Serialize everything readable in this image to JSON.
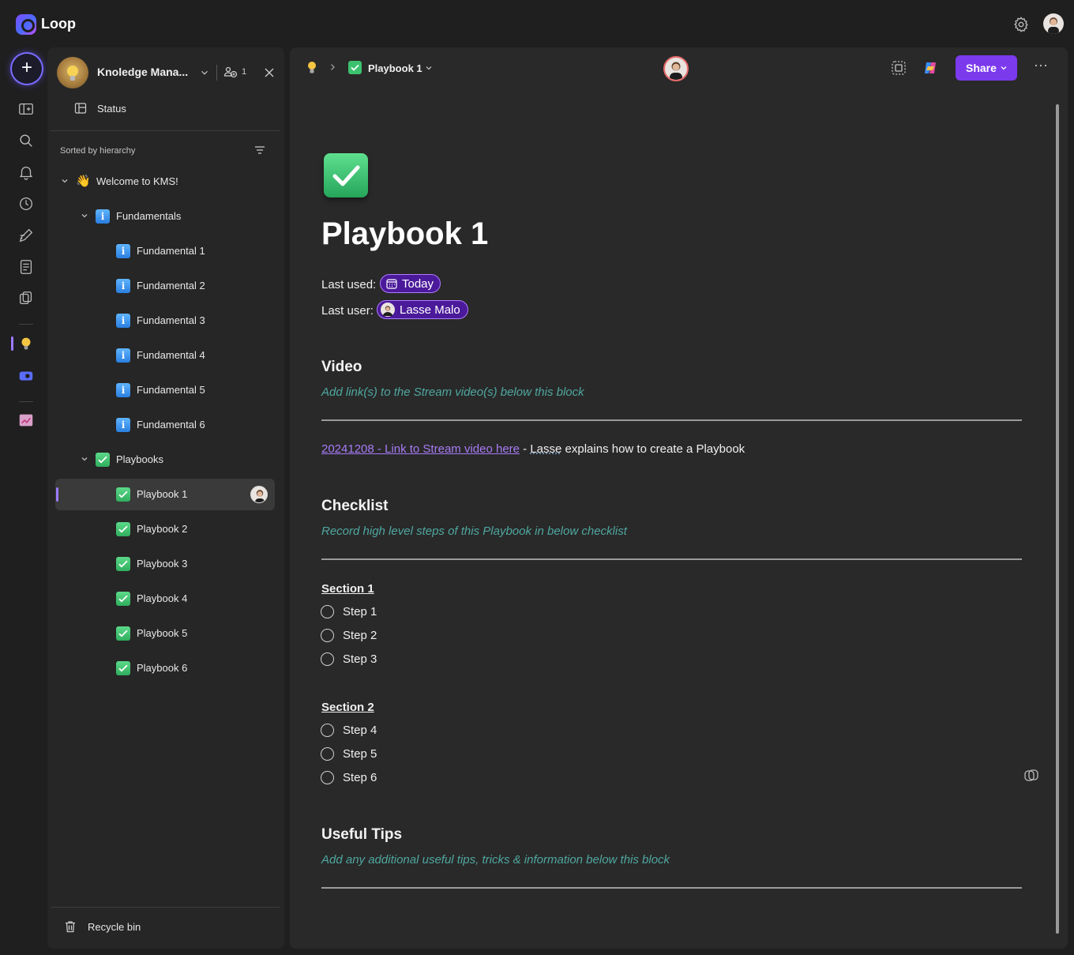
{
  "app": {
    "name": "Loop"
  },
  "workspace": {
    "name": "Knoledge Mana...",
    "members_count": "1"
  },
  "sidebar": {
    "status_label": "Status",
    "sort_label": "Sorted by hierarchy",
    "tree": [
      {
        "label": "Welcome to KMS!",
        "level": 0,
        "icon": "waving-hand-icon",
        "expanded": true
      },
      {
        "label": "Fundamentals",
        "level": 1,
        "icon": "info-icon",
        "expanded": true
      },
      {
        "label": "Fundamental 1",
        "level": 2,
        "icon": "info-icon"
      },
      {
        "label": "Fundamental 2",
        "level": 2,
        "icon": "info-icon"
      },
      {
        "label": "Fundamental 3",
        "level": 2,
        "icon": "info-icon"
      },
      {
        "label": "Fundamental 4",
        "level": 2,
        "icon": "info-icon"
      },
      {
        "label": "Fundamental 5",
        "level": 2,
        "icon": "info-icon"
      },
      {
        "label": "Fundamental 6",
        "level": 2,
        "icon": "info-icon"
      },
      {
        "label": "Playbooks",
        "level": 1,
        "icon": "checkmark-icon",
        "expanded": true
      },
      {
        "label": "Playbook 1",
        "level": 2,
        "icon": "checkmark-icon",
        "active": true
      },
      {
        "label": "Playbook 2",
        "level": 2,
        "icon": "checkmark-icon"
      },
      {
        "label": "Playbook 3",
        "level": 2,
        "icon": "checkmark-icon"
      },
      {
        "label": "Playbook 4",
        "level": 2,
        "icon": "checkmark-icon"
      },
      {
        "label": "Playbook 5",
        "level": 2,
        "icon": "checkmark-icon"
      },
      {
        "label": "Playbook 6",
        "level": 2,
        "icon": "checkmark-icon"
      }
    ],
    "recycle_label": "Recycle bin"
  },
  "toolbar": {
    "breadcrumb_page": "Playbook 1",
    "share_label": "Share",
    "more_label": "···"
  },
  "page": {
    "title": "Playbook 1",
    "last_used_label": "Last used:",
    "last_used_value": "Today",
    "last_user_label": "Last user:",
    "last_user_value": "Lasse Malo",
    "video": {
      "heading": "Video",
      "hint": "Add link(s) to the Stream video(s) below this block",
      "link_text": "20241208 - Link to Stream video here",
      "link_suffix_1": " - ",
      "link_suffix_name": "Lasse",
      "link_suffix_2": " explains how to create a Playbook"
    },
    "checklist": {
      "heading": "Checklist",
      "hint": "Record high level steps of this Playbook in below checklist",
      "sections": [
        {
          "title": "Section 1",
          "steps": [
            "Step 1",
            "Step 2",
            "Step 3"
          ]
        },
        {
          "title": "Section 2",
          "steps": [
            "Step 4",
            "Step 5",
            "Step 6"
          ]
        }
      ]
    },
    "tips": {
      "heading": "Useful Tips",
      "hint": "Add any additional useful tips, tricks & information below this block"
    }
  },
  "colors": {
    "accent": "#7c3aed",
    "hint": "#4fa7a0",
    "link": "#a77bf5",
    "pill_bg": "#4b1a9a"
  }
}
